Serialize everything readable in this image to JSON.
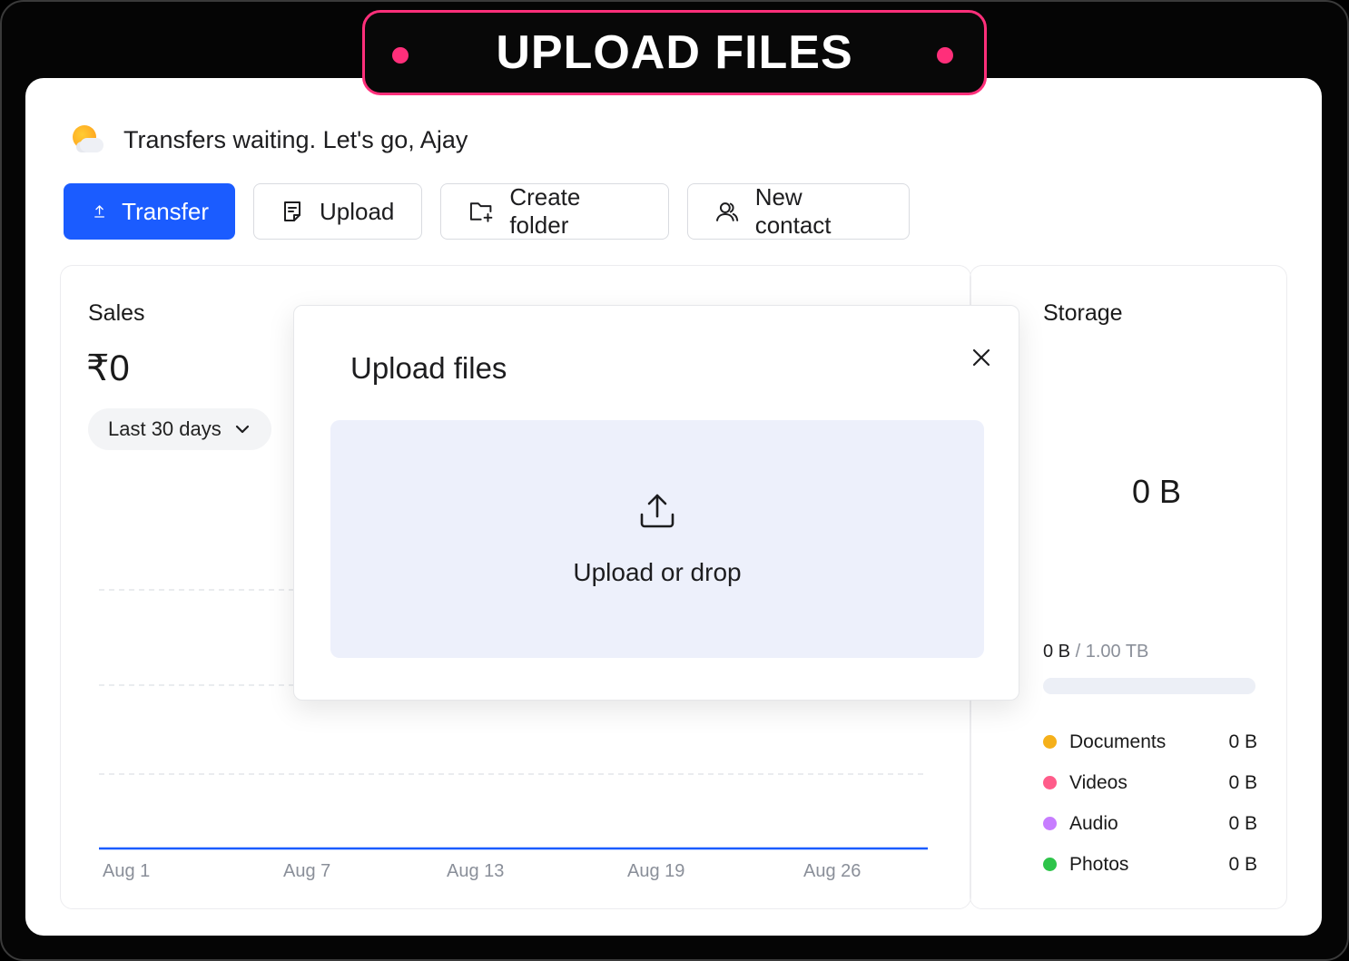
{
  "banner": {
    "title": "UPLOAD FILES"
  },
  "greeting": {
    "text": "Transfers waiting. Let's go, Ajay",
    "icon": "sun-cloud-icon"
  },
  "actions": {
    "transfer": "Transfer",
    "upload": "Upload",
    "create_folder": "Create folder",
    "new_contact": "New contact"
  },
  "sales": {
    "title": "Sales",
    "value": "₹0",
    "range": "Last 30 days"
  },
  "chart_data": {
    "type": "line",
    "x": [
      "Aug 1",
      "Aug 7",
      "Aug 13",
      "Aug 19",
      "Aug 26"
    ],
    "series": [
      {
        "values": [
          0,
          0,
          0,
          0,
          0
        ]
      }
    ],
    "title": "",
    "xlabel": "",
    "ylabel": "",
    "grid": true,
    "line_color": "#1b5cff"
  },
  "storage": {
    "title": "Storage",
    "total_used": "0 B",
    "used": "0 B",
    "capacity": "/ 1.00 TB",
    "used_fraction": 0,
    "categories": [
      {
        "name": "Documents",
        "size": "0 B",
        "color": "#f5b01a"
      },
      {
        "name": "Videos",
        "size": "0 B",
        "color": "#ff5c8a"
      },
      {
        "name": "Audio",
        "size": "0 B",
        "color": "#c77dff"
      },
      {
        "name": "Photos",
        "size": "0 B",
        "color": "#2ec44a"
      }
    ]
  },
  "modal": {
    "title": "Upload files",
    "dropzone_text": "Upload or drop"
  },
  "colors": {
    "accent": "#1b5cff",
    "banner_border": "#ff2f7a"
  }
}
